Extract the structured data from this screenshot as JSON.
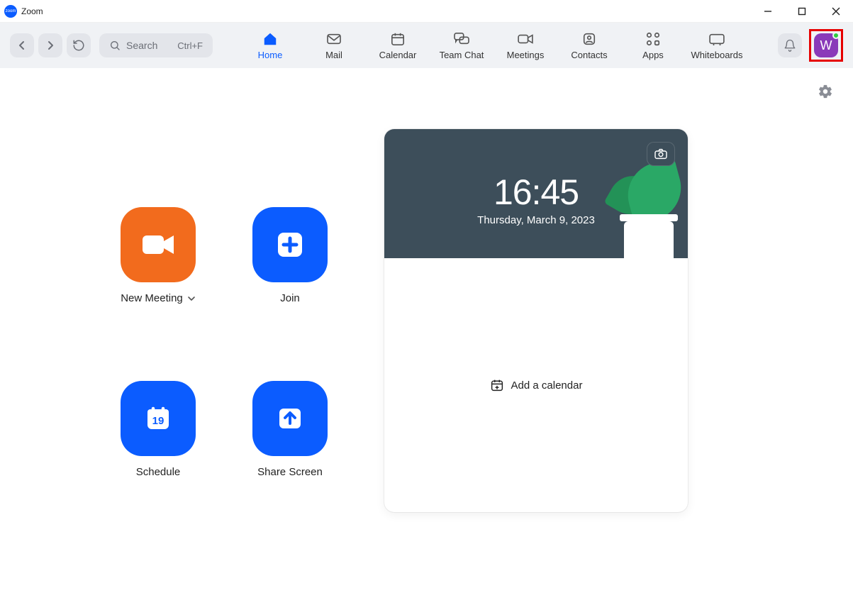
{
  "titlebar": {
    "app_name": "Zoom"
  },
  "toolbar": {
    "search_placeholder": "Search",
    "search_shortcut": "Ctrl+F",
    "tabs": [
      {
        "label": "Home"
      },
      {
        "label": "Mail"
      },
      {
        "label": "Calendar"
      },
      {
        "label": "Team Chat"
      },
      {
        "label": "Meetings"
      },
      {
        "label": "Contacts"
      },
      {
        "label": "Apps"
      },
      {
        "label": "Whiteboards"
      }
    ],
    "avatar_initial": "W"
  },
  "home": {
    "actions": {
      "new_meeting": "New Meeting",
      "join": "Join",
      "schedule": "Schedule",
      "schedule_day_number": "19",
      "share_screen": "Share Screen"
    },
    "panel": {
      "time": "16:45",
      "date": "Thursday, March 9, 2023",
      "add_calendar": "Add a calendar"
    }
  }
}
